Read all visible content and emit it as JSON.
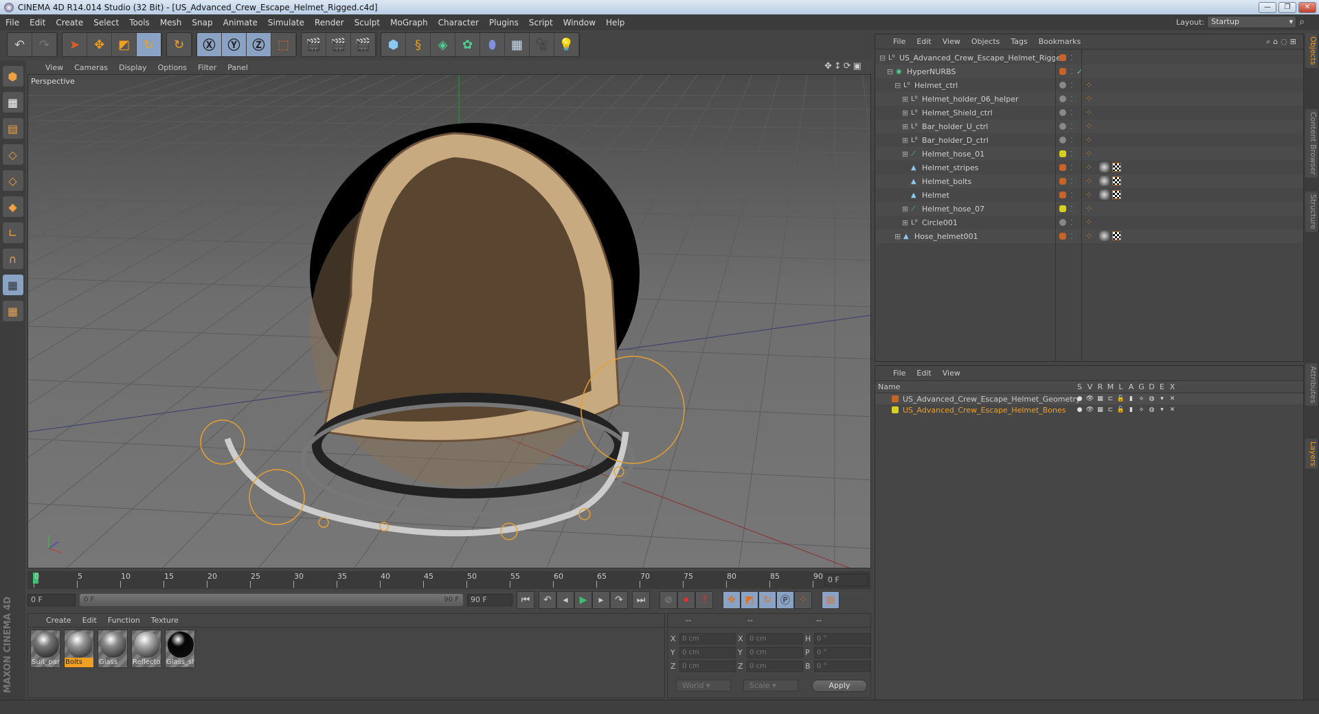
{
  "title": "CINEMA 4D R14.014 Studio (32 Bit) - [US_Advanced_Crew_Escape_Helmet_Rigged.c4d]",
  "menu": [
    "File",
    "Edit",
    "Create",
    "Select",
    "Tools",
    "Mesh",
    "Snap",
    "Animate",
    "Simulate",
    "Render",
    "Sculpt",
    "MoGraph",
    "Character",
    "Plugins",
    "Script",
    "Window",
    "Help"
  ],
  "layout": {
    "label": "Layout:",
    "value": "Startup"
  },
  "viewport": {
    "menu": [
      "View",
      "Cameras",
      "Display",
      "Options",
      "Filter",
      "Panel"
    ],
    "label": "Perspective"
  },
  "timeline": {
    "ticks": [
      "0",
      "5",
      "10",
      "15",
      "20",
      "25",
      "30",
      "35",
      "40",
      "45",
      "50",
      "55",
      "60",
      "65",
      "70",
      "75",
      "80",
      "85",
      "90"
    ],
    "current": "0 F",
    "start": "0 F",
    "range_start": "0 F",
    "range_end": "90 F",
    "end": "90 F"
  },
  "materials": {
    "menu": [
      "Create",
      "Edit",
      "Function",
      "Texture"
    ],
    "items": [
      {
        "name": "Suit_par",
        "ball": "#777"
      },
      {
        "name": "Bolts",
        "ball": "#999",
        "selected": true
      },
      {
        "name": "Glass",
        "ball": "#8a8a8a"
      },
      {
        "name": "Reflecto",
        "ball": "#aaa"
      },
      {
        "name": "Glass_sh",
        "ball": "#050505"
      }
    ]
  },
  "coords": {
    "headers": [
      "--",
      "--",
      "--"
    ],
    "rows": [
      {
        "a": "X",
        "av": "0 cm",
        "b": "X",
        "bv": "0 cm",
        "c": "H",
        "cv": "0 °"
      },
      {
        "a": "Y",
        "av": "0 cm",
        "b": "Y",
        "bv": "0 cm",
        "c": "P",
        "cv": "0 °"
      },
      {
        "a": "Z",
        "av": "0 cm",
        "b": "Z",
        "bv": "0 cm",
        "c": "B",
        "cv": "0 °"
      }
    ],
    "mode": "World",
    "type": "Scale",
    "apply": "Apply"
  },
  "objects": {
    "menu": [
      "File",
      "Edit",
      "View",
      "Objects",
      "Tags",
      "Bookmarks"
    ],
    "rows": [
      {
        "name": "US_Advanced_Crew_Escape_Helmet_Rigged",
        "depth": 0,
        "icon": "null",
        "color": "#c8642a"
      },
      {
        "name": "HyperNURBS",
        "depth": 1,
        "icon": "nurbs",
        "color": "#c8642a",
        "check": "✓"
      },
      {
        "name": "Helmet_ctrl",
        "depth": 2,
        "icon": "null",
        "color": "#888"
      },
      {
        "name": "Helmet_holder_06_helper",
        "depth": 3,
        "icon": "null",
        "color": "#888"
      },
      {
        "name": "Helmet_Shield_ctrl",
        "depth": 3,
        "icon": "null",
        "color": "#888"
      },
      {
        "name": "Bar_holder_U_ctrl",
        "depth": 3,
        "icon": "null",
        "color": "#888"
      },
      {
        "name": "Bar_holder_D_ctrl",
        "depth": 3,
        "icon": "null",
        "color": "#888"
      },
      {
        "name": "Helmet_hose_01",
        "depth": 3,
        "icon": "bone",
        "color": "#d8d020"
      },
      {
        "name": "Helmet_stripes",
        "depth": 3,
        "icon": "poly",
        "color": "#c8642a"
      },
      {
        "name": "Helmet_bolts",
        "depth": 3,
        "icon": "poly",
        "color": "#c8642a"
      },
      {
        "name": "Helmet",
        "depth": 3,
        "icon": "poly",
        "color": "#c8642a"
      },
      {
        "name": "Helmet_hose_07",
        "depth": 3,
        "icon": "bone",
        "color": "#d8d020"
      },
      {
        "name": "Circle001",
        "depth": 3,
        "icon": "null",
        "color": "#888"
      },
      {
        "name": "Hose_helmet001",
        "depth": 2,
        "icon": "poly",
        "color": "#c8642a"
      }
    ]
  },
  "layers": {
    "menu": [
      "File",
      "Edit",
      "View"
    ],
    "columns": [
      "Name",
      "S",
      "V",
      "R",
      "M",
      "L",
      "A",
      "G",
      "D",
      "E",
      "X"
    ],
    "rows": [
      {
        "name": "US_Advanced_Crew_Escape_Helmet_Geometry",
        "color": "#c8642a"
      },
      {
        "name": "US_Advanced_Crew_Escape_Helmet_Bones",
        "color": "#d8d020",
        "active": true
      }
    ]
  },
  "sidetabs": [
    "Objects",
    "Content Browser",
    "Structure",
    "Attributes",
    "Layers"
  ],
  "brand": "MAXON CINEMA 4D"
}
